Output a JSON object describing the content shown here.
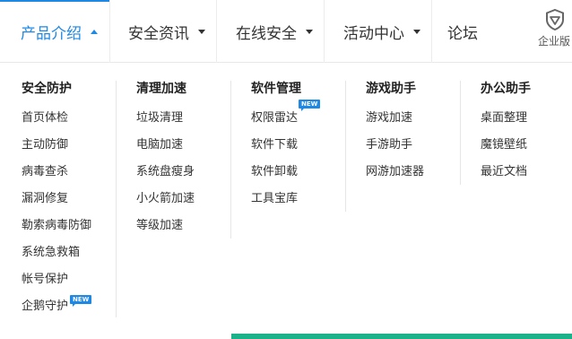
{
  "nav": {
    "items": [
      {
        "label": "产品介绍"
      },
      {
        "label": "安全资讯"
      },
      {
        "label": "在线安全"
      },
      {
        "label": "活动中心"
      },
      {
        "label": "论坛"
      }
    ],
    "enterprise_label": "企业版",
    "accent_color": "#1e88e5"
  },
  "dropdown": {
    "columns": [
      {
        "title": "安全防护",
        "items": [
          "首页体检",
          "主动防御",
          "病毒查杀",
          "漏洞修复",
          "勒索病毒防御",
          "系统急救箱",
          "帐号保护",
          "企鹅守护"
        ]
      },
      {
        "title": "清理加速",
        "items": [
          "垃圾清理",
          "电脑加速",
          "系统盘瘦身",
          "小火箭加速",
          "等级加速"
        ]
      },
      {
        "title": "软件管理",
        "items": [
          "权限雷达",
          "软件下载",
          "软件卸载",
          "工具宝库"
        ]
      },
      {
        "title": "游戏助手",
        "items": [
          "游戏加速",
          "手游助手",
          "网游加速器"
        ]
      },
      {
        "title": "办公助手",
        "items": [
          "桌面整理",
          "魔镜壁纸",
          "最近文档"
        ]
      }
    ],
    "badge_label": "NEW"
  }
}
